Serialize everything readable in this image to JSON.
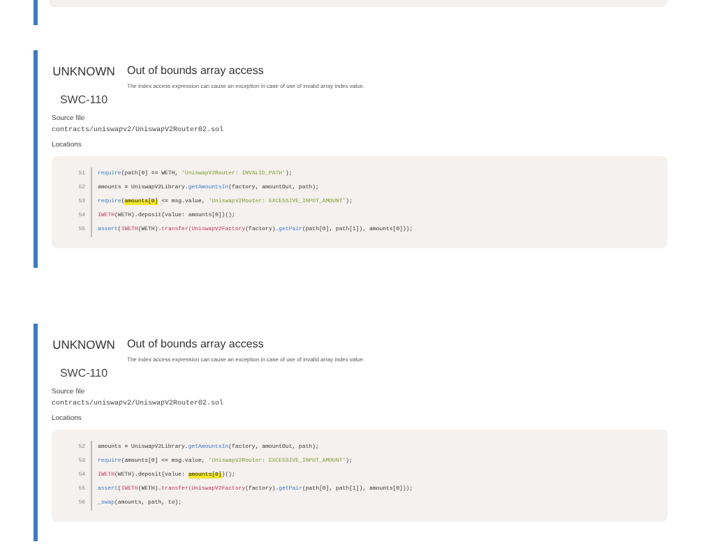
{
  "issues": [
    {
      "severity": "UNKNOWN",
      "swc": "SWC-110",
      "title": "Out of bounds array access",
      "description": "The index access expression can cause an exception in case of use of invalid array index value.",
      "source_label": "Source file",
      "source_path": "contracts/uniswapv2/UniswapV2Router02.sol",
      "locations_label": "Locations",
      "lines": [
        {
          "number": "51",
          "tokens": [
            {
              "kind": "fn",
              "text": "require"
            },
            {
              "kind": "plain",
              "text": "(path[0] == WETH, "
            },
            {
              "kind": "str",
              "text": "'UniswapV2Router: INVALID_PATH'"
            },
            {
              "kind": "plain",
              "text": ");"
            }
          ]
        },
        {
          "number": "52",
          "tokens": [
            {
              "kind": "plain",
              "text": "amounts = UniswapV2Library."
            },
            {
              "kind": "fn",
              "text": "getAmountsIn"
            },
            {
              "kind": "plain",
              "text": "(factory, amountOut, path);"
            }
          ]
        },
        {
          "number": "53",
          "tokens": [
            {
              "kind": "fn",
              "text": "require"
            },
            {
              "kind": "plain",
              "text": "("
            },
            {
              "kind": "hl",
              "text": "amounts[0]"
            },
            {
              "kind": "plain",
              "text": " <= msg.value, "
            },
            {
              "kind": "str",
              "text": "'UniswapV2Router: EXCESSIVE_INPUT_AMOUNT'"
            },
            {
              "kind": "plain",
              "text": ");"
            }
          ]
        },
        {
          "number": "54",
          "tokens": [
            {
              "kind": "kw",
              "text": "IWETH"
            },
            {
              "kind": "plain",
              "text": "(WETH).deposit{value: amounts[0]}();"
            }
          ]
        },
        {
          "number": "55",
          "tokens": [
            {
              "kind": "fn",
              "text": "assert"
            },
            {
              "kind": "plain",
              "text": "("
            },
            {
              "kind": "kw",
              "text": "IWETH"
            },
            {
              "kind": "plain",
              "text": "(WETH)."
            },
            {
              "kind": "kw",
              "text": "transfer(UniswapV2Factory"
            },
            {
              "kind": "plain",
              "text": "(factory)."
            },
            {
              "kind": "fn",
              "text": "getPair"
            },
            {
              "kind": "plain",
              "text": "(path[0], path[1]), amounts[0]));"
            }
          ]
        }
      ]
    },
    {
      "severity": "UNKNOWN",
      "swc": "SWC-110",
      "title": "Out of bounds array access",
      "description": "The index access expression can cause an exception in case of use of invalid array index value.",
      "source_label": "Source file",
      "source_path": "contracts/uniswapv2/UniswapV2Router02.sol",
      "locations_label": "Locations",
      "lines": [
        {
          "number": "52",
          "tokens": [
            {
              "kind": "plain",
              "text": "amounts = UniswapV2Library."
            },
            {
              "kind": "fn",
              "text": "getAmountsIn"
            },
            {
              "kind": "plain",
              "text": "(factory, amountOut, path);"
            }
          ]
        },
        {
          "number": "53",
          "tokens": [
            {
              "kind": "fn",
              "text": "require"
            },
            {
              "kind": "plain",
              "text": "(amounts[0] <= msg.value, "
            },
            {
              "kind": "str",
              "text": "'UniswapV2Router: EXCESSIVE_INPUT_AMOUNT'"
            },
            {
              "kind": "plain",
              "text": ");"
            }
          ]
        },
        {
          "number": "54",
          "tokens": [
            {
              "kind": "kw",
              "text": "IWETH"
            },
            {
              "kind": "plain",
              "text": "(WETH).deposit{value: "
            },
            {
              "kind": "hl",
              "text": "amounts[0]"
            },
            {
              "kind": "plain",
              "text": "}();"
            }
          ]
        },
        {
          "number": "55",
          "tokens": [
            {
              "kind": "fn",
              "text": "assert"
            },
            {
              "kind": "plain",
              "text": "("
            },
            {
              "kind": "kw",
              "text": "IWETH"
            },
            {
              "kind": "plain",
              "text": "(WETH)."
            },
            {
              "kind": "kw",
              "text": "transfer(UniswapV2Factory"
            },
            {
              "kind": "plain",
              "text": "(factory)."
            },
            {
              "kind": "fn",
              "text": "getPair"
            },
            {
              "kind": "plain",
              "text": "(path[0], path[1]), amounts[0]));"
            }
          ]
        },
        {
          "number": "56",
          "tokens": [
            {
              "kind": "fn",
              "text": "_swap"
            },
            {
              "kind": "plain",
              "text": "(amounts, path, to);"
            }
          ]
        }
      ]
    }
  ]
}
